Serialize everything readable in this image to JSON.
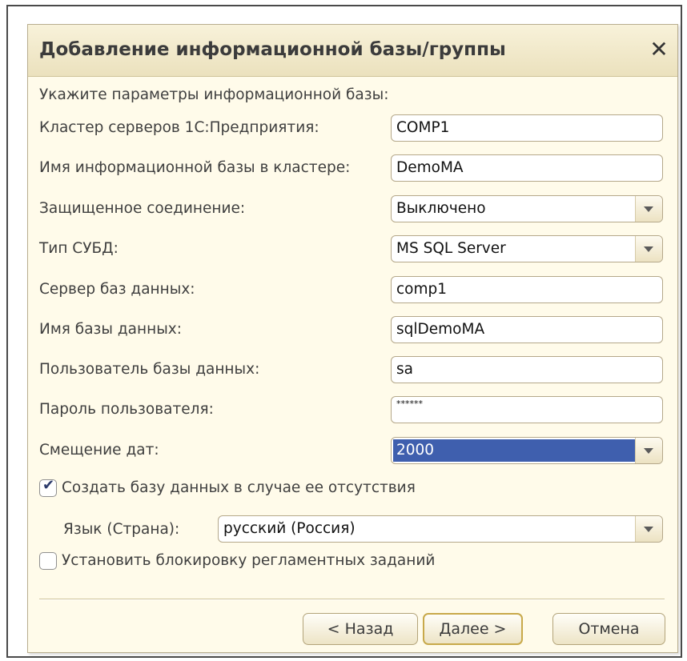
{
  "dialog": {
    "title": "Добавление информационной базы/группы",
    "close_glyph": "✕",
    "prompt": "Укажите параметры информационной базы:"
  },
  "fields": {
    "cluster": {
      "label": "Кластер серверов 1С:Предприятия:",
      "value": "COMP1"
    },
    "infobase_name": {
      "label": "Имя информационной базы в кластере:",
      "value": "DemoMA"
    },
    "secure_connection": {
      "label": "Защищенное соединение:",
      "value": "Выключено"
    },
    "dbms_type": {
      "label": "Тип СУБД:",
      "value": "MS SQL Server"
    },
    "db_server": {
      "label": "Сервер баз данных:",
      "value": "comp1"
    },
    "db_name": {
      "label": "Имя базы данных:",
      "value": "sqlDemoMA"
    },
    "db_user": {
      "label": "Пользователь базы данных:",
      "value": "sa"
    },
    "db_password": {
      "label": "Пароль пользователя:",
      "value": "******"
    },
    "date_offset": {
      "label": "Смещение дат:",
      "value": "2000"
    }
  },
  "options": {
    "create_db": {
      "label": "Создать базу данных в случае ее отсутствия",
      "checked": true,
      "check_glyph": "✔"
    },
    "language": {
      "label": "Язык (Страна):",
      "value": "русский (Россия)"
    },
    "block_jobs": {
      "label": "Установить блокировку регламентных заданий",
      "checked": false
    }
  },
  "buttons": {
    "back": "< Назад",
    "next": "Далее >",
    "cancel": "Отмена"
  },
  "colors": {
    "dialog_bg": "#fffbea",
    "titlebar_bg": "#ebe1bd",
    "selection": "#3f5fae",
    "border": "#b5a88a"
  },
  "icons": {
    "close": "close-icon",
    "dropdown": "chevron-down-icon",
    "check": "checkmark-icon"
  }
}
